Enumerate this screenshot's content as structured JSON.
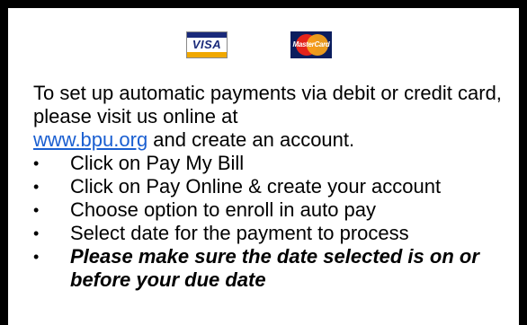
{
  "logos": {
    "visa": "VISA",
    "mastercard": "MasterCard"
  },
  "intro": {
    "line1": "To set up automatic payments via debit or credit card, please visit us online at",
    "link": "www.bpu.org",
    "line2": " and create an account."
  },
  "steps": [
    "Click on Pay My Bill",
    "Click on Pay Online & create your account",
    "Choose option to enroll in auto pay",
    "Select date for the payment to process",
    "Please make sure the date selected is on or before your due date"
  ],
  "bullet_glyph": "•",
  "colors": {
    "link": "#1a5fd1",
    "border": "#000000",
    "visa_blue": "#1a2a7a",
    "visa_gold": "#f0a800",
    "mc_red": "#e4231b",
    "mc_yellow": "#f6a11a"
  }
}
